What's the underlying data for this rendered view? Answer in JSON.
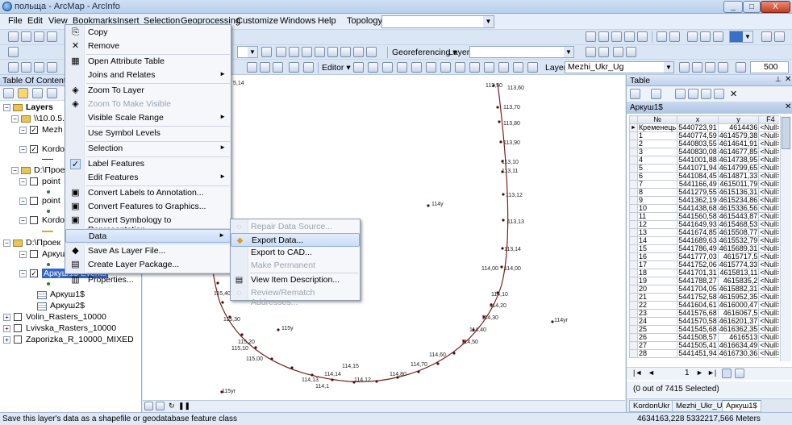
{
  "window": {
    "title": "польща - ArcMap - ArcInfo",
    "controls": {
      "minimize": "_",
      "maximize": "□",
      "close": "X"
    }
  },
  "menubar": {
    "items": [
      "File",
      "Edit",
      "View",
      "Bookmarks",
      "Insert",
      "Selection",
      "Geoprocessing",
      "Customize",
      "Windows",
      "Help"
    ],
    "topology_label": "Topology:"
  },
  "toolbars": {
    "georeferencing_label": "Georeferencing ▾",
    "layer_label": "Layer:",
    "editor_label": "Editor ▾",
    "layer2_label": "Layer:",
    "layer2_value": "Mezhi_Ukr_Ug",
    "scale_value": "500"
  },
  "toc": {
    "title": "Table Of Contents",
    "rows": [
      {
        "label": "Layers",
        "kind": "root"
      },
      {
        "label": "\\\\10.0.5.3",
        "kind": "folder"
      },
      {
        "label": "Mezh",
        "kind": "layer",
        "checked": true
      },
      {
        "label": "Kordo",
        "kind": "layer",
        "checked": true
      },
      {
        "label": "D:\\Проек",
        "kind": "folder"
      },
      {
        "label": "point",
        "kind": "layer",
        "checked": false
      },
      {
        "label": "point",
        "kind": "layer",
        "checked": false
      },
      {
        "label": "Kordo",
        "kind": "layer",
        "checked": false
      },
      {
        "label": "D:\\Проек",
        "kind": "folder"
      },
      {
        "label": "Аркуш",
        "kind": "layer",
        "checked": false
      },
      {
        "label": "Аркуш1$ Events",
        "kind": "layer",
        "checked": true,
        "selected": true
      },
      {
        "label": "Аркуш1$",
        "kind": "table"
      },
      {
        "label": "Аркуш2$",
        "kind": "table"
      },
      {
        "label": "Volin_Rasters_10000",
        "kind": "raster",
        "checked": false
      },
      {
        "label": "Lvivska_Rasters_10000",
        "kind": "raster",
        "checked": false
      },
      {
        "label": "Zaporizka_R_10000_MIXED",
        "kind": "raster",
        "checked": false
      }
    ]
  },
  "context_menu": {
    "items": [
      {
        "label": "Copy",
        "icon": "copy-icon",
        "glyph": "⎘"
      },
      {
        "label": "Remove",
        "icon": "remove-icon",
        "glyph": "✕"
      },
      {
        "label": "Open Attribute Table",
        "icon": "attribute-table-icon",
        "glyph": "▦",
        "sep_before": true
      },
      {
        "label": "Joins and Relates",
        "submenu": true
      },
      {
        "label": "Zoom To Layer",
        "icon": "zoom-layer-icon",
        "glyph": "◈",
        "sep_before": true
      },
      {
        "label": "Zoom To Make Visible",
        "disabled": true,
        "icon": "zoom-visible-icon",
        "glyph": "◈"
      },
      {
        "label": "Visible Scale Range",
        "submenu": true
      },
      {
        "label": "Use Symbol Levels",
        "sep_before": true
      },
      {
        "label": "Selection",
        "submenu": true,
        "sep_before": true
      },
      {
        "label": "Label Features",
        "checked": true,
        "sep_before": true
      },
      {
        "label": "Edit Features",
        "submenu": true
      },
      {
        "label": "Convert Labels to Annotation...",
        "icon": "convert-labels-icon",
        "glyph": "▣",
        "sep_before": true
      },
      {
        "label": "Convert Features to Graphics...",
        "icon": "convert-features-icon",
        "glyph": "▣"
      },
      {
        "label": "Convert Symbology to Representation...",
        "icon": "convert-symbology-icon",
        "glyph": "▣"
      },
      {
        "label": "Data",
        "submenu": true,
        "highlighted": true,
        "sep_before": true
      },
      {
        "label": "Save As Layer File...",
        "icon": "layer-file-icon",
        "glyph": "◆",
        "sep_before": true
      },
      {
        "label": "Create Layer Package...",
        "icon": "layer-package-icon",
        "glyph": "▤"
      },
      {
        "label": "Properties...",
        "icon": "properties-icon",
        "glyph": "▥",
        "sep_before": true
      }
    ]
  },
  "data_submenu": {
    "items": [
      {
        "label": "Repair Data Source...",
        "disabled": true,
        "glyph": "◌"
      },
      {
        "label": "Export Data...",
        "highlighted": true,
        "glyph": "◆"
      },
      {
        "label": "Export to CAD..."
      },
      {
        "label": "Make Permanent",
        "disabled": true
      },
      {
        "label": "View Item Description...",
        "glyph": "▤",
        "sep_before": true
      },
      {
        "label": "Review/Rematch Addresses...",
        "disabled": true,
        "glyph": "◌"
      }
    ]
  },
  "map": {
    "labels": [
      "5,14",
      "113,50",
      "113,60",
      "113,70",
      "113,80",
      "113,90",
      "113,10",
      "113,11",
      "113,12",
      "114у",
      "113,13",
      "113,14",
      "114,00",
      "114,00",
      "114,10",
      "114,20",
      "114,30",
      "114,40",
      "114,50",
      "114,60",
      "114,70",
      "114,80",
      "114,15",
      "114,14",
      "114,13",
      "114,12",
      "114,1",
      "115,40",
      "115,30",
      "115,20",
      "115,10",
      "115,00",
      "115у",
      "115уг",
      "114уг"
    ]
  },
  "table_window": {
    "title": "Table",
    "layer_name": "Аркуш1$",
    "headers": [
      "№",
      "x",
      "y",
      "F4"
    ],
    "rows": [
      [
        "Кременець",
        "5440723,91",
        "4614436",
        "<Null>"
      ],
      [
        "1",
        "5440774,59",
        "4614579,38",
        "<Null>"
      ],
      [
        "2",
        "5440803,55",
        "4614641,91",
        "<Null>"
      ],
      [
        "3",
        "5440830,08",
        "4614677,85",
        "<Null>"
      ],
      [
        "4",
        "5441001,88",
        "4614738,95",
        "<Null>"
      ],
      [
        "5",
        "5441071,94",
        "4614799,65",
        "<Null>"
      ],
      [
        "6",
        "5441084,45",
        "4614871,33",
        "<Null>"
      ],
      [
        "7",
        "5441166,49",
        "4615011,79",
        "<Null>"
      ],
      [
        "8",
        "5441279,55",
        "4615136,31",
        "<Null>"
      ],
      [
        "9",
        "5441362,19",
        "4615234,86",
        "<Null>"
      ],
      [
        "10",
        "5441438,68",
        "4615336,56",
        "<Null>"
      ],
      [
        "11",
        "5441560,58",
        "4615443,87",
        "<Null>"
      ],
      [
        "12",
        "5441649,93",
        "4615468,53",
        "<Null>"
      ],
      [
        "13",
        "5441674,85",
        "4615508,77",
        "<Null>"
      ],
      [
        "14",
        "5441689,63",
        "4615532,79",
        "<Null>"
      ],
      [
        "15",
        "5441786,49",
        "4615689,31",
        "<Null>"
      ],
      [
        "16",
        "5441777,03",
        "4615717,5",
        "<Null>"
      ],
      [
        "17",
        "5441752,06",
        "4615774,33",
        "<Null>"
      ],
      [
        "18",
        "5441701,31",
        "4615813,11",
        "<Null>"
      ],
      [
        "19",
        "5441788,27",
        "4615835,2",
        "<Null>"
      ],
      [
        "20",
        "5441704,05",
        "4615882,31",
        "<Null>"
      ],
      [
        "21",
        "5441752,58",
        "4615952,35",
        "<Null>"
      ],
      [
        "22",
        "5441604,61",
        "4616000,47",
        "<Null>"
      ],
      [
        "23",
        "5441576,68",
        "4616067,5",
        "<Null>"
      ],
      [
        "24",
        "5441570,58",
        "4616201,37",
        "<Null>"
      ],
      [
        "25",
        "5441545,68",
        "4616362,35",
        "<Null>"
      ],
      [
        "26",
        "5441508,57",
        "4616513",
        "<Null>"
      ],
      [
        "27",
        "5441505,41",
        "4616634,49",
        "<Null>"
      ],
      [
        "28",
        "5441451,94",
        "4616730,36",
        "<Null>"
      ]
    ],
    "nav_page": "1",
    "selection_status": "(0 out of 7415 Selected)",
    "tabs": [
      "KordonUkr",
      "Mezhi_Ukr_Ug",
      "Аркуш1$"
    ],
    "active_tab": 2
  },
  "statusbar": {
    "message": "Save this layer's data as a shapefile or geodatabase feature class",
    "coordinates": "4634163,228  5332217,566 Meters"
  }
}
